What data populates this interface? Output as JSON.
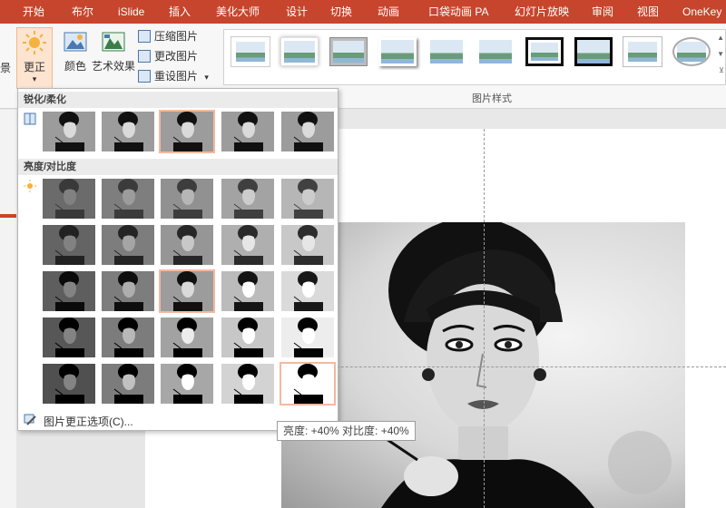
{
  "ribbon_tabs": [
    "开始",
    "布尔",
    "iSlide",
    "插入",
    "美化大师",
    "设计",
    "切换",
    "动画",
    "口袋动画 PA",
    "幻灯片放映",
    "审阅",
    "视图",
    "OneKey"
  ],
  "adjust_group": {
    "corrections_label": "更正",
    "color_label": "颜色",
    "artistic_label": "艺术效果",
    "compress_label": "压缩图片",
    "change_label": "更改图片",
    "reset_label": "重设图片",
    "left_cut_label": "景"
  },
  "picture_styles": {
    "group_label": "图片样式",
    "items": [
      "simple-frame-white",
      "soft-edge-rect",
      "beveled-matte",
      "drop-shadow-rect",
      "reflected-rounded",
      "reflected-rect",
      "simple-frame-black",
      "thick-black-matte",
      "rotated-white",
      "soft-oval"
    ]
  },
  "corrections_menu": {
    "sharpen_title": "锐化/柔化",
    "brightness_title": "亮度/对比度",
    "options_label": "图片更正选项(C)...",
    "sharpen_count": 5,
    "sharpen_selected_index": 2,
    "brightness_rows": 5,
    "brightness_cols": 5,
    "brightness_selected": [
      [
        2,
        2
      ],
      [
        4,
        4
      ]
    ],
    "brightness_levels": [
      -40,
      -20,
      0,
      20,
      40
    ],
    "contrast_levels": [
      -40,
      -20,
      0,
      20,
      40
    ]
  },
  "tooltip": "亮度: +40% 对比度: +40%",
  "colors": {
    "ribbon_accent": "#c7452c",
    "selection_outline": "#f4b9a0",
    "selected_button_bg": "#fce4d0"
  }
}
